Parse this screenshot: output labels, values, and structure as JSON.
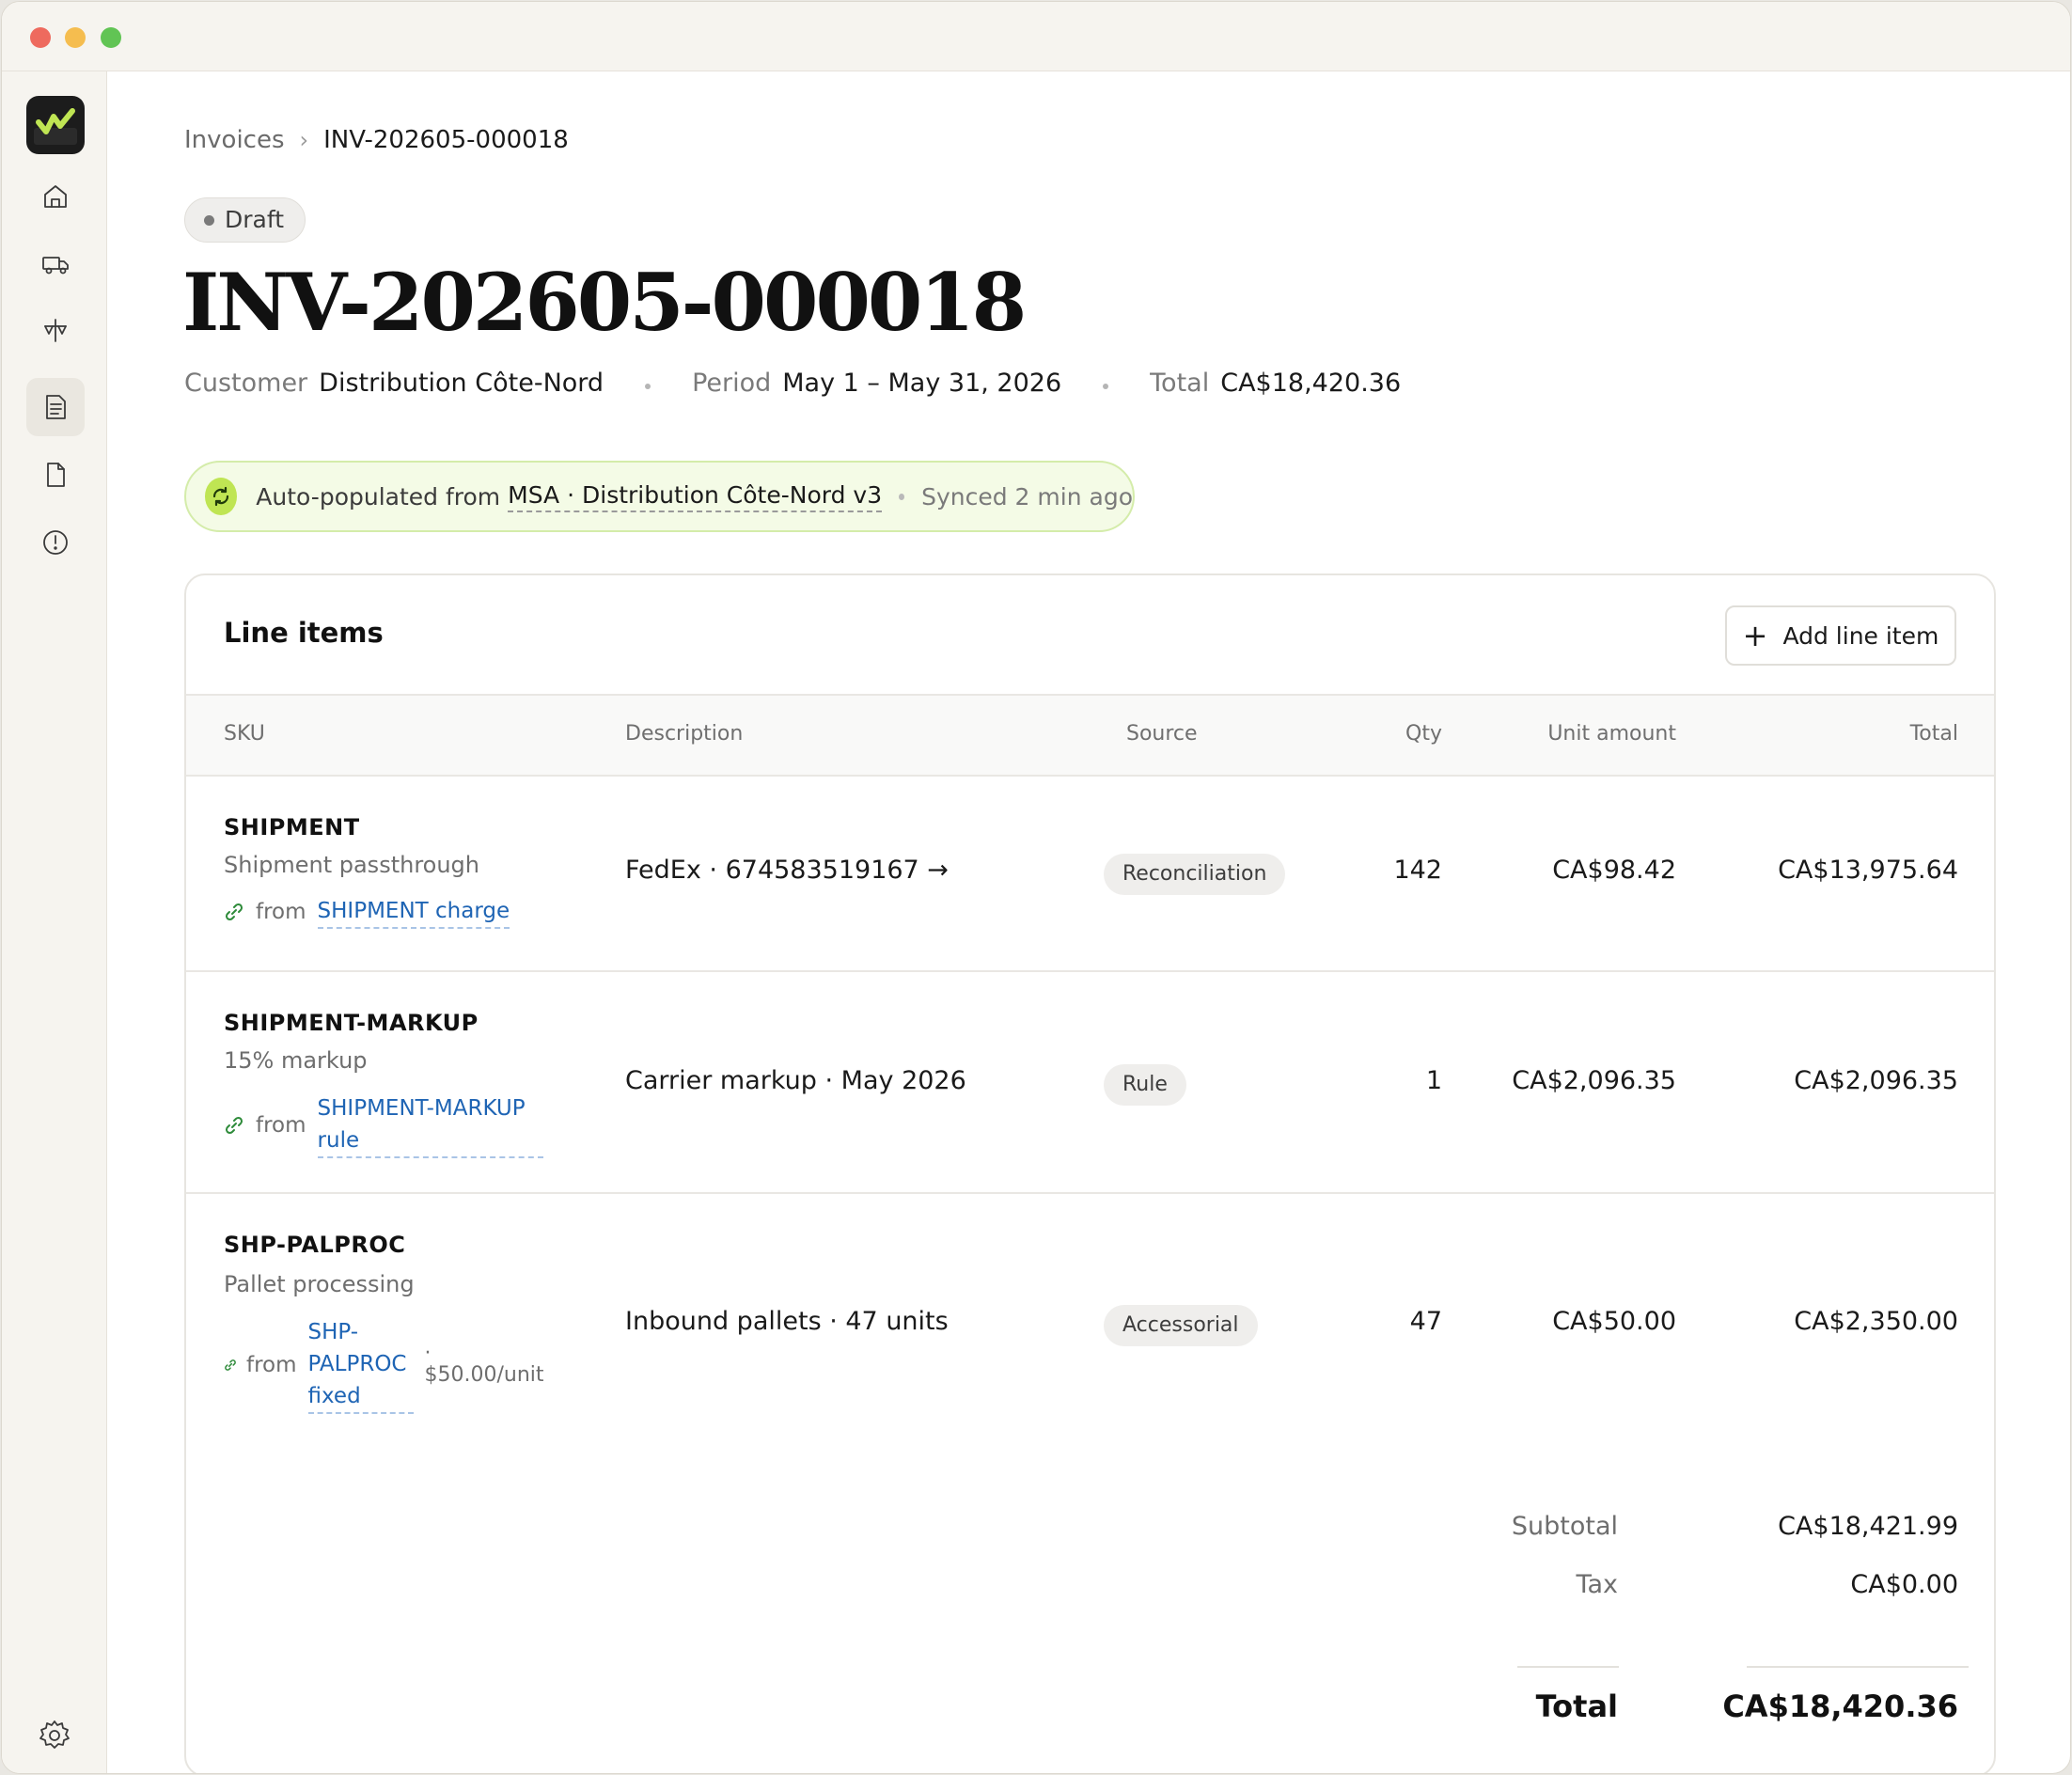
{
  "breadcrumb": {
    "parent": "Invoices",
    "separator": "›",
    "current": "INV-202605-000018"
  },
  "status": "Draft",
  "title": "INV-202605-000018",
  "meta": {
    "customer_label": "Customer",
    "customer": "Distribution Côte-Nord",
    "period_label": "Period",
    "period": "May 1 – May 31, 2026",
    "total_label": "Total",
    "total": "CA$18,420.36"
  },
  "banner": {
    "text": "Auto-populated from",
    "link": "MSA · Distribution Côte-Nord v3",
    "sync": "Synced 2 min ago"
  },
  "line_items": {
    "title": "Line items",
    "add_button": "Add line item",
    "columns": {
      "sku": "SKU",
      "description": "Description",
      "source": "Source",
      "qty": "Qty",
      "unit_amount": "Unit amount",
      "total": "Total"
    },
    "rows": [
      {
        "sku": "SHIPMENT",
        "subtitle": "Shipment passthrough",
        "from": "from",
        "from_link": "SHIPMENT charge",
        "description": "FedEx · 674583519167 →",
        "source": "Reconciliation",
        "qty": "142",
        "unit_amount": "CA$98.42",
        "total": "CA$13,975.64"
      },
      {
        "sku": "SHIPMENT-MARKUP",
        "subtitle": "15% markup",
        "from": "from",
        "from_link_1": "SHIPMENT-MARKUP",
        "from_link_2": "rule",
        "description": "Carrier markup · May 2026",
        "source": "Rule",
        "qty": "1",
        "unit_amount": "CA$2,096.35",
        "total": "CA$2,096.35"
      },
      {
        "sku": "SHP-PALPROC",
        "subtitle": "Pallet processing",
        "from": "from",
        "from_link_1": "SHP-",
        "from_link_2": "PALPROC",
        "from_link_3": "fixed",
        "unit_note_dot": "·",
        "unit_note": "$50.00/unit",
        "description": "Inbound pallets · 47 units",
        "source": "Accessorial",
        "qty": "47",
        "unit_amount": "CA$50.00",
        "total": "CA$2,350.00"
      }
    ],
    "summary": {
      "subtotal_label": "Subtotal",
      "subtotal": "CA$18,421.99",
      "tax_label": "Tax",
      "tax": "CA$0.00",
      "total_label": "Total",
      "total": "CA$18,420.36"
    }
  },
  "colors": {
    "accent": "#bfe553",
    "link": "#1e64b4",
    "logo_bg": "#1c1c1c"
  },
  "icons": [
    "home-icon",
    "truck-icon",
    "scale-icon",
    "invoice-icon",
    "document-icon",
    "alert-icon",
    "settings-icon",
    "sync-icon",
    "link-icon",
    "plus-icon"
  ]
}
